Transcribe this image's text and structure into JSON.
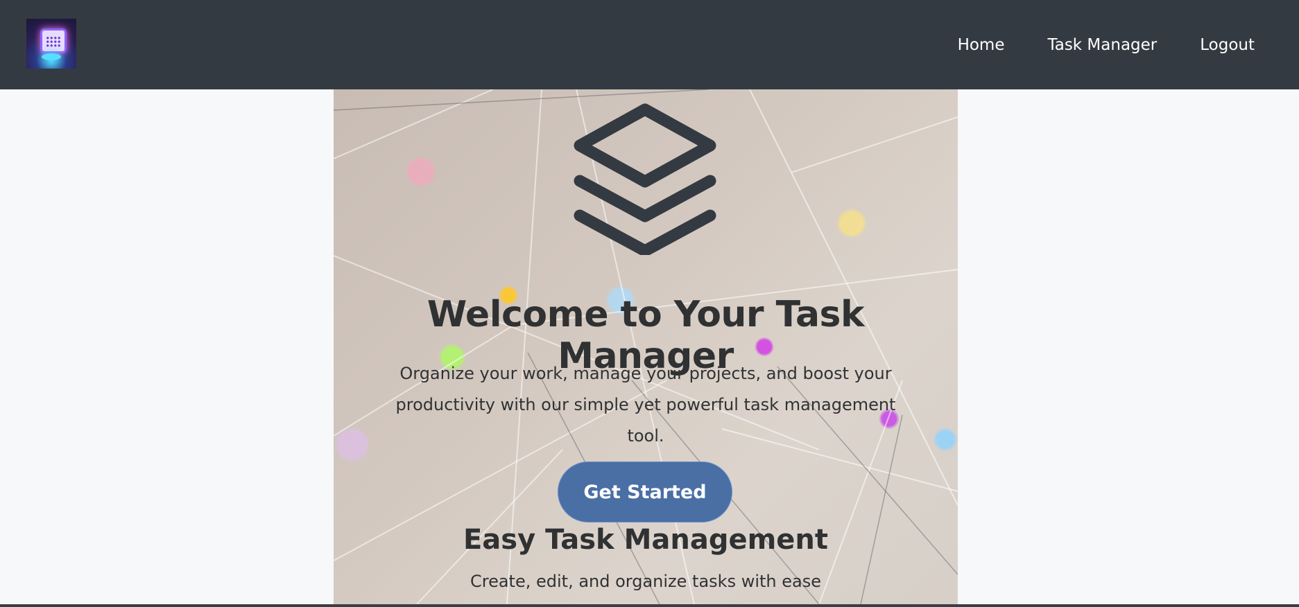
{
  "navbar": {
    "logo_icon": "calendar-hologram-logo",
    "links": [
      {
        "label": "Home"
      },
      {
        "label": "Task Manager"
      },
      {
        "label": "Logout"
      }
    ],
    "background": "#343a42"
  },
  "hero": {
    "icon": "layers-icon",
    "title": "Welcome to Your Task Manager",
    "subtitle": "Organize your work, manage your projects, and boost your productivity with our simple yet powerful task management tool.",
    "cta_label": "Get Started",
    "cta_color": "#4a6fa5"
  },
  "features": [
    {
      "title": "Easy Task Management",
      "description": "Create, edit, and organize tasks with ease"
    }
  ]
}
